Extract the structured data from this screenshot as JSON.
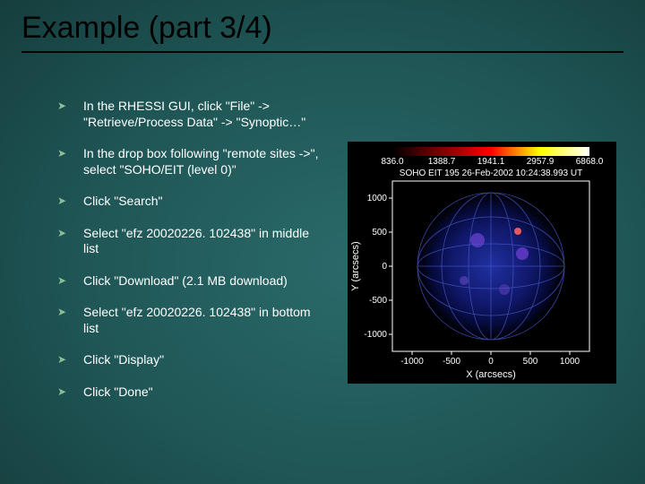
{
  "title": "Example (part 3/4)",
  "bullets": [
    "In the RHESSI GUI, click \"File\" -> \"Retrieve/Process Data\" -> \"Synoptic…\"",
    "In the drop box following \"remote sites ->\", select \"SOHO/EIT (level 0)\"",
    "Click \"Search\"",
    "Select \"efz 20020226. 102438\" in middle list",
    "Click \"Download\" (2.1 MB download)",
    "Select \"efz 20020226. 102438\" in bottom list",
    "Click \"Display\"",
    "Click \"Done\""
  ],
  "figure": {
    "title": "SOHO EIT 195 26-Feb-2002 10:24:38.993 UT",
    "xlabel": "X (arcsecs)",
    "ylabel": "Y (arcsecs)",
    "x_ticks": [
      "-1000",
      "-500",
      "0",
      "500",
      "1000"
    ],
    "y_ticks": [
      "-1000",
      "-500",
      "0",
      "500",
      "1000"
    ],
    "colorbar_ticks": [
      "836.0",
      "1388.7",
      "1941.1",
      "2957.9",
      "6868.0"
    ]
  }
}
